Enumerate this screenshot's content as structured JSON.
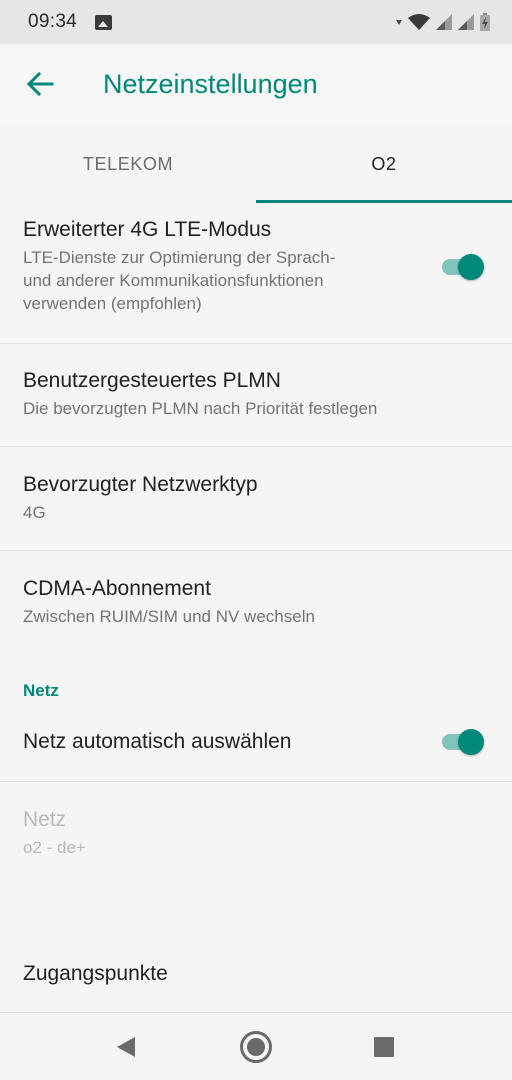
{
  "status_bar": {
    "time": "09:34",
    "icons": [
      "image-icon",
      "data-arrows-icon",
      "wifi-icon",
      "signal-icon",
      "signal-icon",
      "battery-icon"
    ]
  },
  "app_bar": {
    "title": "Netzeinstellungen",
    "back_icon": "arrow-back-icon"
  },
  "tabs": [
    {
      "label": "TELEKOM",
      "selected": false
    },
    {
      "label": "O2",
      "selected": true
    }
  ],
  "preferences": {
    "lte": {
      "title": "Erweiterter 4G LTE-Modus",
      "summary_lines": [
        "LTE-Dienste zur Optimierung der Sprach-",
        "und anderer Kommunikationsfunktionen",
        "verwenden (empfohlen)"
      ],
      "checked": true
    },
    "plmn": {
      "title": "Benutzergesteuertes PLMN",
      "summary": "Die bevorzugten PLMN nach Priorität festlegen"
    },
    "network_type": {
      "title": "Bevorzugter Netzwerktyp",
      "summary": "4G"
    },
    "cdma": {
      "title": "CDMA-Abonnement",
      "summary": "Zwischen RUIM/SIM und NV wechseln"
    }
  },
  "section": {
    "header": "Netz",
    "auto_select": {
      "title": "Netz automatisch auswählen",
      "checked": true
    },
    "network": {
      "title": "Netz",
      "summary": "o2 - de+",
      "enabled": false
    }
  },
  "access_points": {
    "title": "Zugangspunkte"
  },
  "colors": {
    "accent": "#00897b",
    "track": "#80c4bd"
  },
  "nav_bar": {
    "icons": [
      "back-triangle-icon",
      "home-circle-icon",
      "recents-square-icon"
    ]
  }
}
